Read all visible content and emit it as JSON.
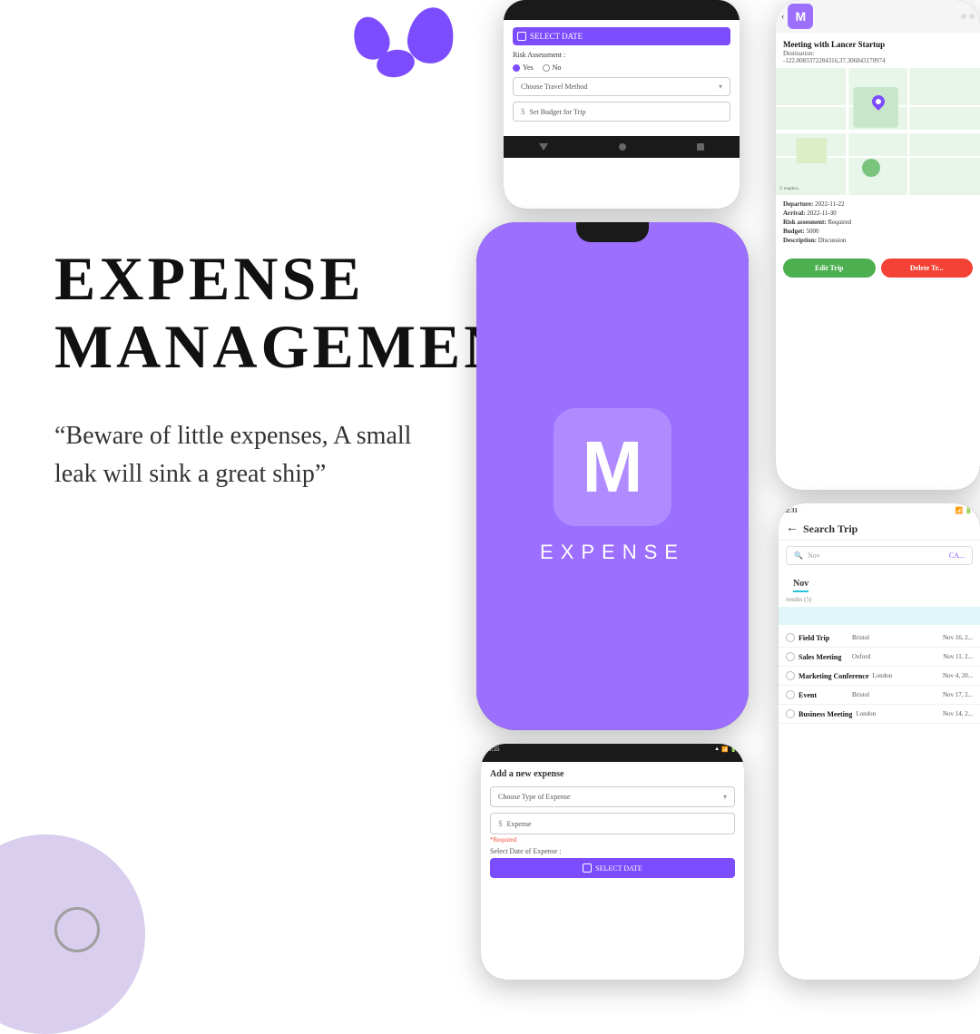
{
  "page": {
    "background": "#ffffff"
  },
  "left_content": {
    "title_line1": "EXPENSE",
    "title_line2": "MANAGEMENT",
    "quote": "“Beware of little expenses, A small leak will sink a great ship”"
  },
  "phone1": {
    "select_date_label": "SELECT DATE",
    "risk_label": "Risk Assessment :",
    "yes_label": "Yes",
    "no_label": "No",
    "travel_method_placeholder": "Choose Travel Method",
    "budget_placeholder": "Set Budget for Trip"
  },
  "phone2": {
    "logo_letter": "M",
    "app_name": "EXPENSE"
  },
  "phone3": {
    "logo_letter": "M",
    "trip_title": "Meeting with Lancer Startup",
    "destination_label": "Destination:",
    "destination_value": "-122.0083372284316,37.306843170974",
    "departure_label": "Departure:",
    "departure_value": "2022-11-22",
    "arrival_label": "Arrival:",
    "arrival_value": "2022-11-30",
    "risk_label": "Risk assesment:",
    "risk_value": "Required",
    "budget_label": "Budget:",
    "budget_value": "5000",
    "description_label": "Description:",
    "description_value": "Discussion",
    "edit_btn": "Edit Trip",
    "delete_btn": "Delete Tr...",
    "mapbox_label": "© mapbox"
  },
  "phone4": {
    "add_expense_title": "Add a new expense",
    "type_placeholder": "Choose Type of Expense",
    "expense_placeholder": "Expense",
    "required_text": "*Required",
    "date_label": "Select Date of Expense :",
    "select_date_btn": "SELECT DATE"
  },
  "phone5": {
    "time": "2:31",
    "title": "Search Trip",
    "search_placeholder": "Nov",
    "cancel_label": "CA...",
    "results_text": "results (5)",
    "trips": [
      {
        "name": "Field Trip",
        "city": "Bristol",
        "date": "Nov 16, 2..."
      },
      {
        "name": "Sales Meeting",
        "city": "Oxford",
        "date": "Nov 11, 2..."
      },
      {
        "name": "Marketing Conference",
        "city": "London",
        "date": "Nov 4, 20..."
      },
      {
        "name": "Event",
        "city": "Bristol",
        "date": "Nov 17, 2..."
      },
      {
        "name": "Business Meeting",
        "city": "London",
        "date": "Nov 14, 2..."
      }
    ]
  },
  "icons": {
    "calendar": "📅",
    "dollar": "$",
    "chevron_down": "▾",
    "back_arrow": "←",
    "search": "🔍"
  }
}
